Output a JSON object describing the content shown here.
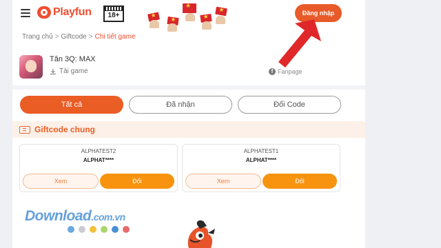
{
  "header": {
    "logo_text": "Playfun",
    "age_rating": "18+",
    "login_label": "Đăng nhập"
  },
  "breadcrumb": {
    "items": [
      "Trang chủ",
      "Giftcode"
    ],
    "separator": ">",
    "current": "Chi tiết game"
  },
  "game": {
    "name": "Tân 3Q: MAX",
    "download_label": "Tải game",
    "fanpage_label": "Fanpage"
  },
  "tabs": [
    {
      "label": "Tất cả",
      "active": true
    },
    {
      "label": "Đã nhận",
      "active": false
    },
    {
      "label": "Đổi Code",
      "active": false
    }
  ],
  "section": {
    "title": "Giftcode chung"
  },
  "giftcodes": [
    {
      "name": "ALPHATEST2",
      "code": "ALPHAT****",
      "view_label": "Xem",
      "redeem_label": "Đổi"
    },
    {
      "name": "ALPHATEST1",
      "code": "ALPHAT****",
      "view_label": "Xem",
      "redeem_label": "Đổi"
    }
  ],
  "watermark": {
    "text": "Download",
    "suffix": ".com.vn",
    "dot_colors": [
      "#6aa8e0",
      "#c9ccd1",
      "#f2c03a",
      "#a8d66a",
      "#4a8fd6",
      "#e96a6a"
    ]
  },
  "colors": {
    "brand": "#ef4e32",
    "accent": "#ea5d25",
    "redeem": "#f7930f",
    "arrow": "#e0282a"
  }
}
